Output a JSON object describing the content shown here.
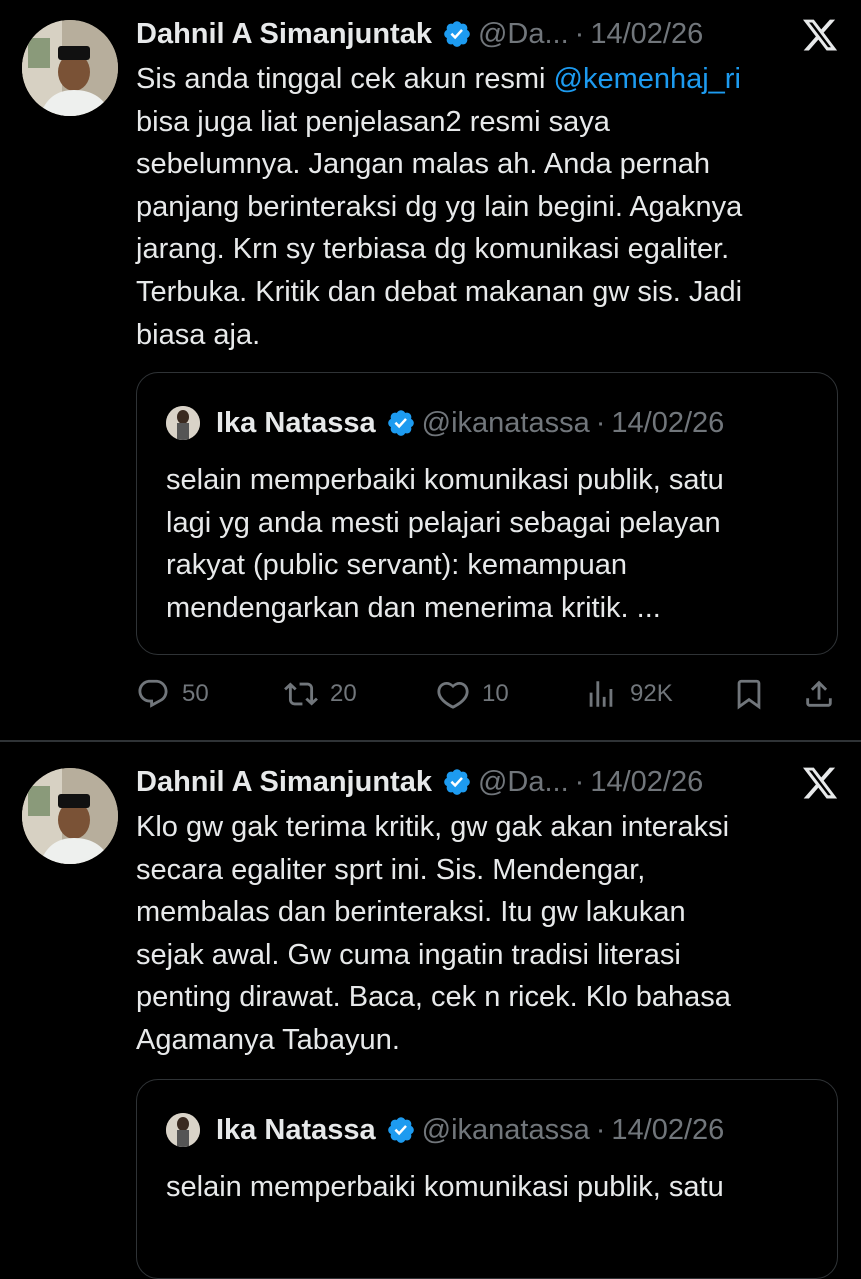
{
  "tweets": [
    {
      "author": {
        "name": "Dahnil A Simanjuntak",
        "handle": "@Da...",
        "date": "14/02/26"
      },
      "text_before_mention": "Sis anda tinggal cek akun resmi ",
      "mention": "@kemenhaj_ri",
      "text_after_mention": "\nbisa juga liat penjelasan2 resmi saya\nsebelumnya. Jangan malas ah. Anda pernah\npanjang berinteraksi dg yg lain begini. Agaknya\njarang. Krn sy terbiasa dg komunikasi egaliter.\nTerbuka. Kritik dan debat makanan gw sis. Jadi\nbiasa aja.",
      "quote": {
        "name": "Ika Natassa",
        "handle": "@ikanatassa",
        "date": "14/02/26",
        "text": "selain memperbaiki komunikasi publik, satu\nlagi yg anda mesti pelajari sebagai pelayan\nrakyat (public servant): kemampuan\nmendengarkan dan menerima kritik. ..."
      },
      "actions": {
        "replies": "50",
        "reposts": "20",
        "likes": "10",
        "views": "92K"
      }
    },
    {
      "author": {
        "name": "Dahnil A Simanjuntak",
        "handle": "@Da...",
        "date": "14/02/26"
      },
      "text": "Klo gw gak terima kritik, gw gak akan interaksi\nsecara egaliter sprt ini. Sis. Mendengar,\nmembalas dan berinteraksi. Itu gw lakukan\nsejak awal. Gw cuma ingatin tradisi literasi\npenting dirawat. Baca, cek n ricek. Klo bahasa\nAgamanya Tabayun.",
      "quote": {
        "name": "Ika Natassa",
        "handle": "@ikanatassa",
        "date": "14/02/26",
        "text": "selain memperbaiki komunikasi publik, satu"
      }
    }
  ],
  "separator": "·",
  "colors": {
    "background": "#000000",
    "text": "#e7e9ea",
    "muted": "#71767b",
    "link": "#1d9bf0",
    "border": "#2f3336"
  },
  "icons": [
    "verified-badge-icon",
    "x-logo-icon",
    "reply-icon",
    "repost-icon",
    "like-icon",
    "views-icon",
    "bookmark-icon",
    "share-icon"
  ]
}
